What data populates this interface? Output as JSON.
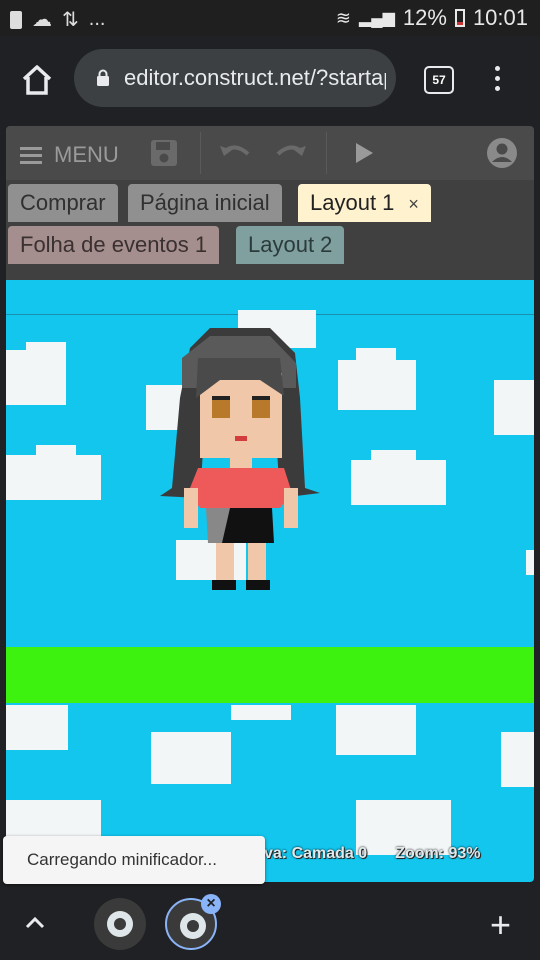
{
  "status_bar": {
    "notification_more": "...",
    "battery": "12%",
    "time": "10:01"
  },
  "browser": {
    "url": "editor.construct.net/?startapp",
    "tab_count": "57"
  },
  "editor": {
    "menu_label": "MENU",
    "tabs_row1": [
      {
        "label": "Comprar"
      },
      {
        "label": "Página inicial"
      },
      {
        "label": "Layout 1",
        "close": "×"
      }
    ],
    "tabs_row2": [
      {
        "label": "Folha de eventos 1"
      },
      {
        "label": "Layout 2"
      }
    ]
  },
  "layout_view": {
    "active_layer": "va: Camada 0",
    "zoom": "Zoom: 93%",
    "colors": {
      "sky": "#12c6ee",
      "ground": "#3df20e",
      "cloud": "#f2f6f7"
    }
  },
  "toast": {
    "message": "Carregando minificador..."
  },
  "bottom_bar": {
    "close_badge": "×",
    "new_tab": "+"
  }
}
